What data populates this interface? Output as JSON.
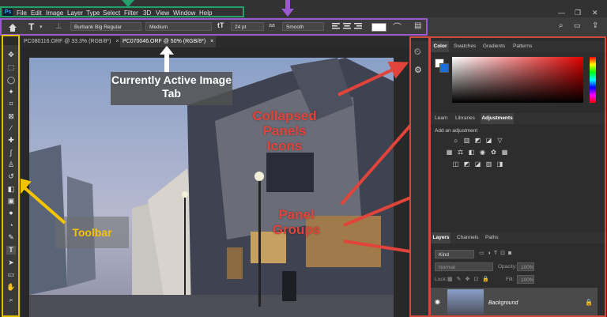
{
  "app": {
    "logo": "Ps"
  },
  "menu": [
    "File",
    "Edit",
    "Image",
    "Layer",
    "Type",
    "Select",
    "Filter",
    "3D",
    "View",
    "Window",
    "Help"
  ],
  "window_controls": [
    "—",
    "❐",
    "✕"
  ],
  "options_bar": {
    "font_family": "Burbank Big Regular",
    "font_style": "Medium",
    "font_size": "24 pt",
    "aa_label": "aa",
    "antialias": "Smooth",
    "type_tool_glyph": "T",
    "size_glyph": "tT"
  },
  "tabs": [
    {
      "label": "PC080116.ORF @ 33.3% (RGB/8*)",
      "close": "×"
    },
    {
      "label": "PC070046.ORF @ 50% (RGB/8*)",
      "close": "×"
    }
  ],
  "annotations": {
    "active_tab": "Currently Active Image Tab",
    "collapsed_line1": "Collapsed",
    "collapsed_line2": "Panels",
    "collapsed_line3": "Icons",
    "panel_groups_line1": "Panel",
    "panel_groups_line2": "Groups",
    "toolbar": "Toolbar"
  },
  "panel_group_color": {
    "tabs": [
      "Color",
      "Swatches",
      "Gradients",
      "Patterns"
    ]
  },
  "panel_group_adjust": {
    "tabs": [
      "Learn",
      "Libraries",
      "Adjustments"
    ],
    "heading": "Add an adjustment"
  },
  "panel_group_layers": {
    "tabs": [
      "Layers",
      "Channels",
      "Paths"
    ],
    "kind_label": "Kind",
    "blend_mode": "Normal",
    "opacity_label": "Opacity:",
    "opacity_value": "100%",
    "lock_label": "Lock:",
    "fill_label": "Fill:",
    "fill_value": "100%",
    "layer_name": "Background"
  },
  "colors": {
    "menu_highlight": "#23a06b",
    "options_highlight": "#9b59d0",
    "toolbar_highlight": "#e0c000",
    "panels_highlight": "#d04a3c",
    "annotation_red": "#e0443a"
  }
}
